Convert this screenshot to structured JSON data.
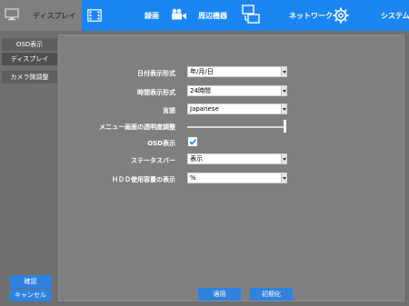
{
  "nav": {
    "display": "ディスプレイ",
    "record": "録画",
    "peripherals": "周辺機器",
    "network": "ネットワーク",
    "system": "システム"
  },
  "sidebar": {
    "items": [
      "OSD表示",
      "ディスプレイ",
      "カメラ微調整"
    ],
    "confirm_label": "確認",
    "cancel_label": "キャンセル"
  },
  "settings": {
    "date_format": {
      "label": "日付表示形式",
      "value": "年/月/日"
    },
    "time_format": {
      "label": "時間表示形式",
      "value": "24時間"
    },
    "language": {
      "label": "言語",
      "value": "Japanese"
    },
    "menu_transparency": {
      "label": "メニュー画面の透明度調整",
      "value": 1.0
    },
    "osd_display": {
      "label": "OSD表示",
      "checked": true
    },
    "status_bar": {
      "label": "ステータスバー",
      "value": "表示"
    },
    "hdd_usage_display": {
      "label": "ＨＤＤ使用容量の表示",
      "value": "%"
    }
  },
  "buttons": {
    "apply_label": "適用",
    "initialize_label": "初期化"
  },
  "colors": {
    "accent": "#1b86f2",
    "button": "#2f83de",
    "background": "#6f6f6f",
    "panel": "#7f7f7f"
  }
}
